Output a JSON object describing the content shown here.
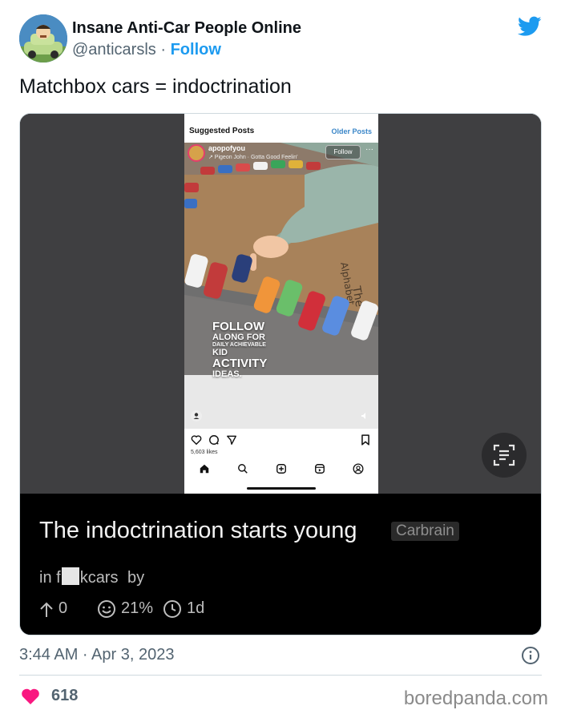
{
  "author": {
    "name": "Insane Anti-Car People Online",
    "handle": "@anticarsls",
    "separator": "·",
    "follow_label": "Follow"
  },
  "tweet": {
    "text": "Matchbox cars = indoctrination",
    "timestamp": "3:44 AM · Apr 3, 2023",
    "likes": "618"
  },
  "embedded_screenshot": {
    "instagram": {
      "suggested_label": "Suggested Posts",
      "older_label": "Older Posts",
      "username": "apopofyou",
      "music": "↗ Pigeon John · Gotta Good Feelin'",
      "follow_label": "Follow",
      "more_glyph": "···",
      "overlay_lines": [
        "FOLLOW",
        "ALONG FOR",
        "DAILY ACHIEVABLE",
        "KID",
        "ACTIVITY",
        "IDEAS."
      ],
      "cardboard_text_1": "Alphabet",
      "cardboard_text_2": "The",
      "likes_partial": "5,603 likes"
    },
    "reddit": {
      "title": "The indoctrination starts young",
      "flair": "Carbrain",
      "community_prefix": "in f",
      "community_suffix": "kcars",
      "by_label": "by",
      "upvotes": "0",
      "upvote_ratio": "21%",
      "age": "1d"
    }
  },
  "watermark": "boredpanda.com",
  "colors": {
    "twitter_blue": "#1d9bf0",
    "heart": "#f91880",
    "secondary_text": "#536471"
  }
}
